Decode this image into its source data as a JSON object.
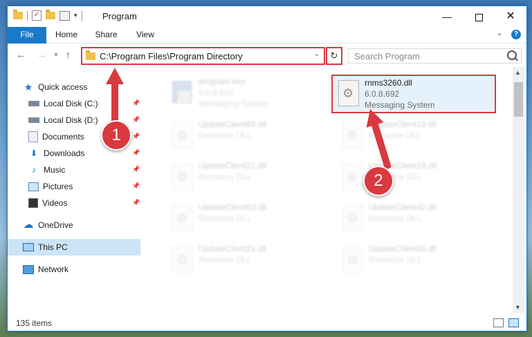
{
  "window": {
    "title": "Program",
    "controls": {
      "minimize": "—",
      "maximize": "",
      "close": "✕"
    }
  },
  "ribbon": {
    "tabs": [
      "File",
      "Home",
      "Share",
      "View"
    ],
    "help": "?"
  },
  "nav": {
    "address": "C:\\Program Files\\Program Directory",
    "search_placeholder": "Search Program"
  },
  "sidebar": {
    "items": [
      {
        "label": "Quick access",
        "icon": "star-icon"
      },
      {
        "label": "Local Disk (C:)",
        "icon": "disk-icon"
      },
      {
        "label": "Local Disk (D:)",
        "icon": "disk-icon"
      },
      {
        "label": "Documents",
        "icon": "documents-icon"
      },
      {
        "label": "Downloads",
        "icon": "downloads-icon"
      },
      {
        "label": "Music",
        "icon": "music-icon"
      },
      {
        "label": "Pictures",
        "icon": "pictures-icon"
      },
      {
        "label": "Videos",
        "icon": "videos-icon"
      },
      {
        "label": "OneDrive",
        "icon": "cloud-icon"
      },
      {
        "label": "This PC",
        "icon": "computer-icon"
      },
      {
        "label": "Network",
        "icon": "network-icon"
      }
    ],
    "selected": "This PC"
  },
  "files": [
    {
      "name": "program.exe",
      "version": "6.0.8.692",
      "description": "Messaging System",
      "type": "exe"
    },
    {
      "name": "rnms3260.dll",
      "version": "6.0.8.692",
      "description": "Messaging System",
      "type": "dll",
      "highlighted": true
    },
    {
      "name": "UpdateClient65.dll",
      "description": "Resource DLL",
      "type": "dll"
    },
    {
      "name": "UpdateClient19.dll",
      "description": "Resource DLL",
      "type": "dll"
    },
    {
      "name": "UpdateClient21.dll",
      "description": "Resource DLL",
      "type": "dll"
    },
    {
      "name": "UpdateClient19.dll",
      "description": "Resource DLL",
      "type": "dll"
    },
    {
      "name": "UpdateClient63.dll",
      "description": "Resource DLL",
      "type": "dll"
    },
    {
      "name": "UpdateClient42.dll",
      "description": "Resource DLL",
      "type": "dll"
    },
    {
      "name": "UpdateClient21.dll",
      "description": "Resource DLL",
      "type": "dll"
    },
    {
      "name": "UpdateClient65.dll",
      "description": "Resource DLL",
      "type": "dll"
    }
  ],
  "status": {
    "item_count": "135 items"
  },
  "annotations": {
    "step1": "1",
    "step2": "2",
    "color": "#d9393f"
  },
  "colors": {
    "accent": "#1979ca",
    "selection": "#cce4f7",
    "annotation": "#d9393f"
  }
}
